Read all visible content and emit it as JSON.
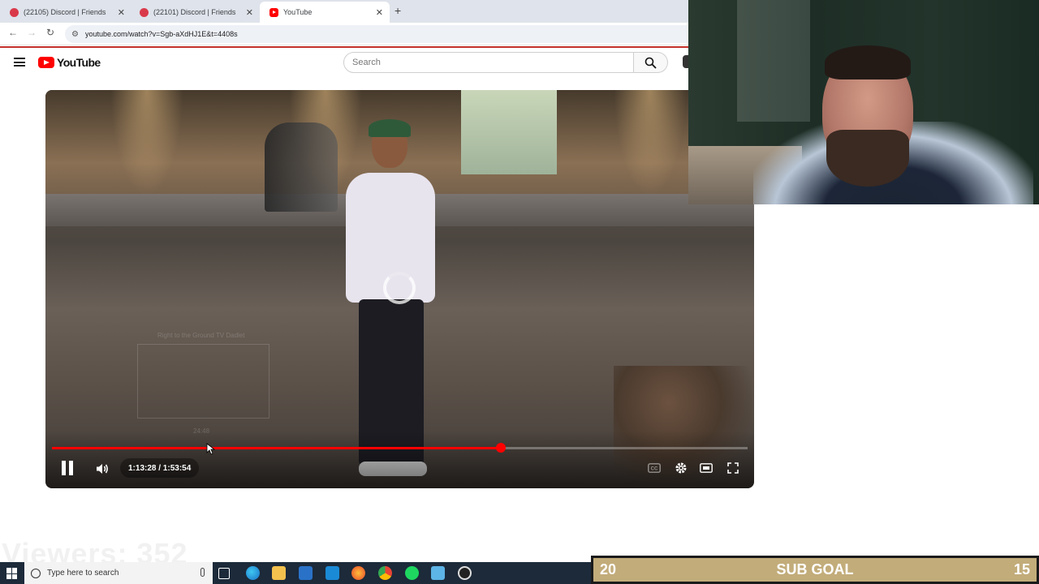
{
  "browser": {
    "tabs": [
      {
        "label": "(22105) Discord | Friends",
        "icon": "discord-icon"
      },
      {
        "label": "(22101) Discord | Friends",
        "icon": "discord-icon"
      },
      {
        "label": "YouTube",
        "icon": "youtube-icon"
      }
    ],
    "new_tab": "+",
    "url": "youtube.com/watch?v=Sgb-aXdHJ1E&t=4408s"
  },
  "youtube": {
    "logo_text": "YouTube",
    "search_placeholder": "Search",
    "player": {
      "current_time": "1:13:28",
      "duration": "1:53:54",
      "time_display": "1:13:28 / 1:53:54",
      "progress_fraction": 0.645,
      "hover_fraction": 0.22,
      "state": "buffering",
      "preview_title": "Right to the Ground TV Dadlet",
      "preview_time": "24:48"
    }
  },
  "overlay": {
    "viewers_text": "Viewers: 352",
    "sub_goal": {
      "current": "20",
      "label": "SUB GOAL",
      "target": "15"
    }
  },
  "taskbar": {
    "search_placeholder": "Type here to search",
    "apps": [
      "task-view-icon",
      "edge-icon",
      "file-explorer-icon",
      "store-icon",
      "mail-icon",
      "firefox-icon",
      "chrome-icon",
      "spotify-icon",
      "app-icon",
      "obs-icon"
    ]
  },
  "colors": {
    "accent_red": "#ff0000",
    "sub_goal_bar": "#c2ac7a",
    "taskbar": "#1c2a3a"
  }
}
